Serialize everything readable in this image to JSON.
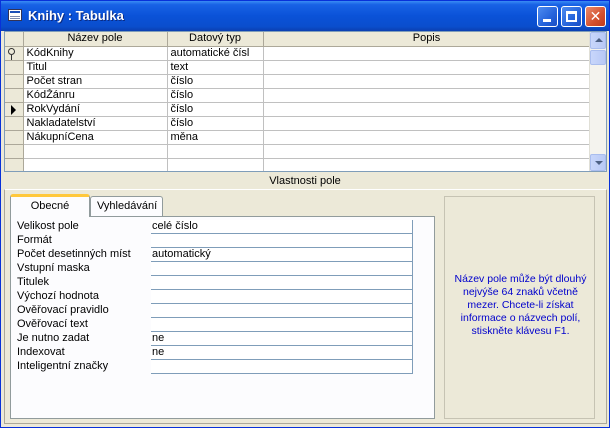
{
  "window": {
    "title": "Knihy : Tabulka",
    "close_glyph": "✕"
  },
  "grid": {
    "columns": [
      "Název pole",
      "Datový typ",
      "Popis"
    ],
    "rows": [
      {
        "name": "KódKnihy",
        "type": "automatické čísl",
        "desc": ""
      },
      {
        "name": "Titul",
        "type": "text",
        "desc": ""
      },
      {
        "name": "Počet stran",
        "type": "číslo",
        "desc": ""
      },
      {
        "name": "KódŽánru",
        "type": "číslo",
        "desc": ""
      },
      {
        "name": "RokVydání",
        "type": "číslo",
        "desc": ""
      },
      {
        "name": "Nakladatelství",
        "type": "číslo",
        "desc": ""
      },
      {
        "name": "NákupníCena",
        "type": "měna",
        "desc": ""
      }
    ]
  },
  "properties": {
    "title": "Vlastnosti pole",
    "tabs": [
      "Obecné",
      "Vyhledávání"
    ],
    "items": [
      {
        "label": "Velikost pole",
        "value": "celé číslo"
      },
      {
        "label": "Formát",
        "value": ""
      },
      {
        "label": "Počet desetinných míst",
        "value": "automatický"
      },
      {
        "label": "Vstupní maska",
        "value": ""
      },
      {
        "label": "Titulek",
        "value": ""
      },
      {
        "label": "Výchozí hodnota",
        "value": ""
      },
      {
        "label": "Ověřovací pravidlo",
        "value": ""
      },
      {
        "label": "Ověřovací text",
        "value": ""
      },
      {
        "label": "Je nutno zadat",
        "value": "ne"
      },
      {
        "label": "Indexovat",
        "value": "ne"
      },
      {
        "label": "Inteligentní značky",
        "value": ""
      }
    ],
    "help_text": "Název pole může být dlouhý nejvýše 64 znaků včetně mezer. Chcete-li získat informace o názvech polí, stiskněte klávesu F1."
  },
  "colors": {
    "titlebar": "#0a52d8",
    "help_text": "#0000cc"
  },
  "icons": [
    "table-icon",
    "minimize-icon",
    "maximize-icon",
    "close-icon",
    "primary-key-icon",
    "current-row-arrow-icon"
  ]
}
